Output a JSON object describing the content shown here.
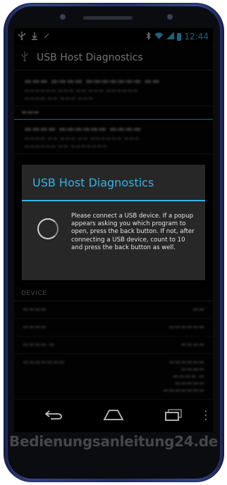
{
  "status_bar": {
    "time": "12:44"
  },
  "action_bar": {
    "title": "USB Host Diagnostics"
  },
  "dialog": {
    "title": "USB Host Diagnostics",
    "message": "Please connect a USB device. If a popup appears asking you which program to open, press the back button. If not, after connecting a USB device, count to 10 and press the back button as well."
  },
  "device_section": {
    "header": "DEVICE"
  },
  "watermark": "Bedienungsanleitung24.de",
  "colors": {
    "accent": "#33b5e5",
    "dialog_bg": "#272727",
    "screen_bg": "#050505"
  },
  "icons": {
    "status_left": [
      "usb-icon",
      "download-icon",
      "notification-icon"
    ],
    "status_right": [
      "bluetooth-icon",
      "wifi-icon",
      "signal-icon",
      "battery-icon"
    ],
    "nav": [
      "back-icon",
      "home-icon",
      "recent-apps-icon",
      "menu-icon"
    ]
  }
}
